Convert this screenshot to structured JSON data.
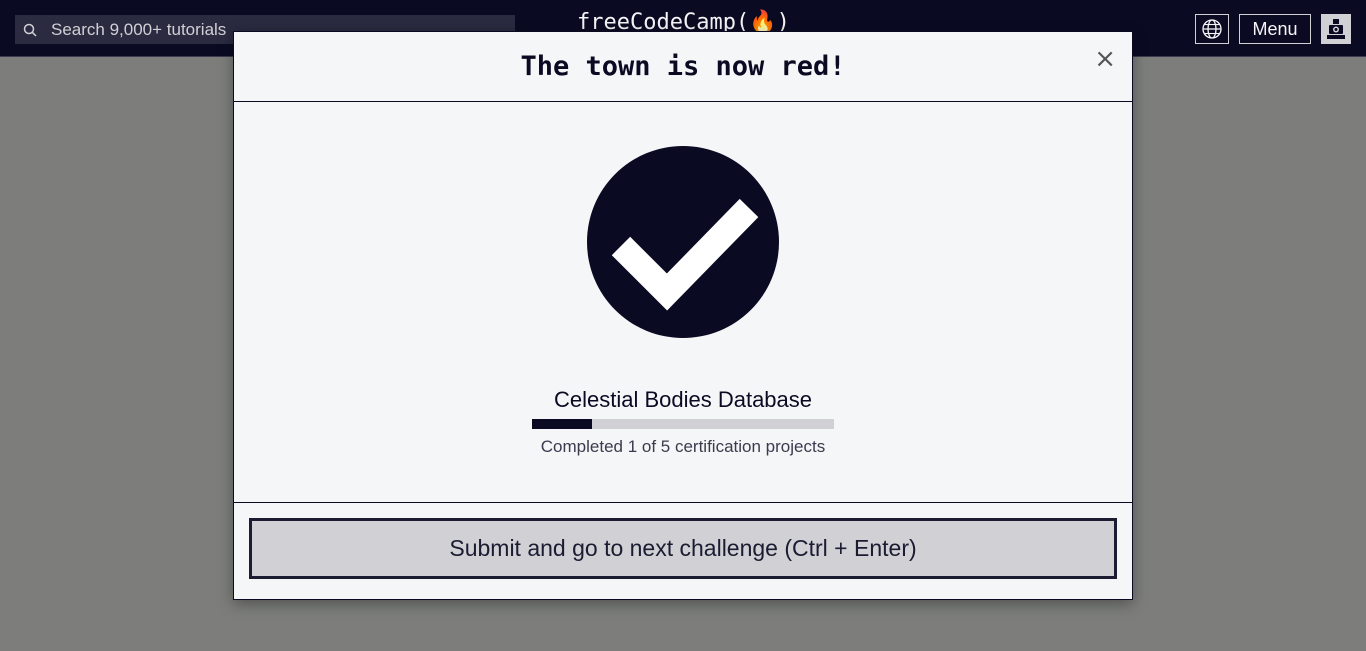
{
  "navbar": {
    "search": {
      "placeholder": "Search 9,000+ tutorials"
    },
    "logo_text": "freeCodeCamp(🔥)",
    "language_icon": "globe-icon",
    "menu_label": "Menu",
    "avatar_icon": "user-avatar-icon"
  },
  "modal": {
    "title": "The town is now red!",
    "close_label": "×",
    "success_icon": "checkmark-circle-icon",
    "project_title": "Celestial Bodies Database",
    "progress": {
      "completed": 1,
      "total": 5,
      "fraction": 0.2
    },
    "progress_text": "Completed 1 of 5 certification projects",
    "submit_label": "Submit and go to next challenge (Ctrl + Enter)"
  },
  "colors": {
    "navbar_bg": "#0a0a23",
    "overlay": "#7d7e7c",
    "modal_bg": "#f5f6f7",
    "accent_dark": "#0a0a23",
    "button_bg": "#d0d0d5"
  }
}
